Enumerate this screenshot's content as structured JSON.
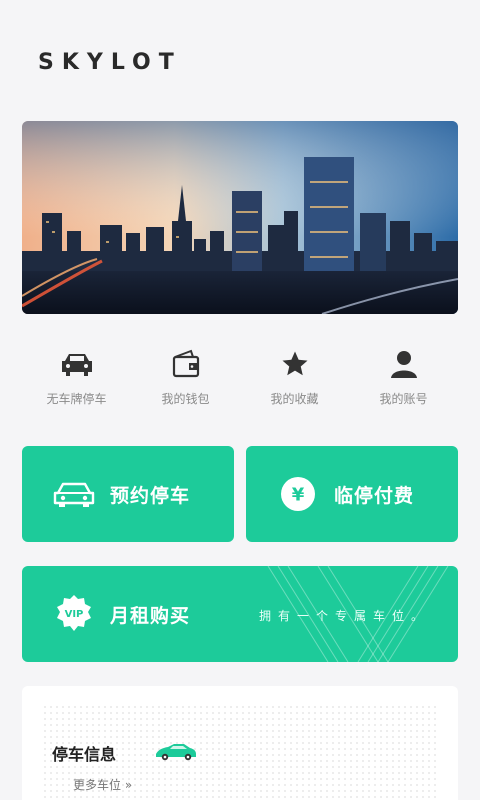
{
  "app": {
    "logo_text": "SKYLOT"
  },
  "banner": {
    "image": "city-skyline-night"
  },
  "quick_actions": [
    {
      "label": "无车牌停车",
      "icon": "car-icon"
    },
    {
      "label": "我的钱包",
      "icon": "wallet-icon"
    },
    {
      "label": "我的收藏",
      "icon": "star-icon"
    },
    {
      "label": "我的账号",
      "icon": "user-icon"
    }
  ],
  "cards": {
    "reserve": {
      "title": "预约停车",
      "icon": "car-outline-icon"
    },
    "pay": {
      "title": "临停付费",
      "icon": "yen-icon",
      "icon_text": "¥"
    },
    "monthly": {
      "title": "月租购买",
      "tagline": "拥有一个专属车位。",
      "icon": "vip-badge-icon",
      "icon_text": "VIP"
    }
  },
  "parking_info": {
    "title": "停车信息",
    "more_link": "更多车位 »"
  },
  "colors": {
    "accent": "#1dcb9a",
    "background": "#f5f5f7",
    "text_muted": "#8a8a8a"
  }
}
